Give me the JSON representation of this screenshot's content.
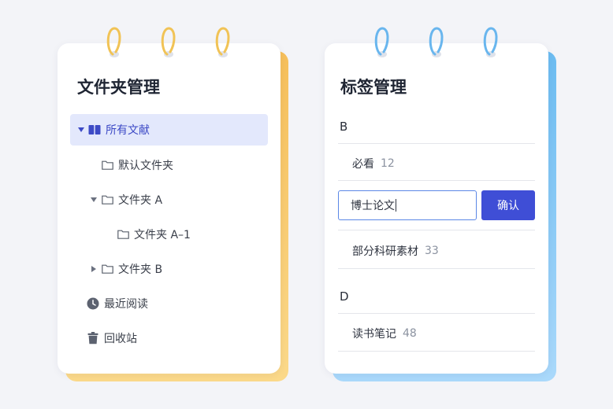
{
  "colors": {
    "left_accent": "#f6bf5b",
    "right_accent": "#6cbcf1",
    "active_bg": "#e3e8fc",
    "active_text": "#3d4ac6",
    "button_bg": "#3f4ed6",
    "input_border": "#5b87e6"
  },
  "folder_panel": {
    "title": "文件夹管理",
    "items": [
      {
        "label": "所有文献",
        "icon": "book-icon",
        "caret": "expanded",
        "active": true
      },
      {
        "label": "默认文件夹",
        "icon": "folder-icon"
      },
      {
        "label": "文件夹 A",
        "icon": "folder-icon",
        "caret": "expanded"
      },
      {
        "label": "文件夹 A–1",
        "icon": "folder-icon"
      },
      {
        "label": "文件夹 B",
        "icon": "folder-icon",
        "caret": "collapsed"
      },
      {
        "label": "最近阅读",
        "icon": "clock-icon"
      },
      {
        "label": "回收站",
        "icon": "trash-icon"
      }
    ]
  },
  "tag_panel": {
    "title": "标签管理",
    "groups": [
      {
        "letter": "B",
        "tags": [
          {
            "name": "必看",
            "count": "12"
          },
          {
            "name": "部分科研素材",
            "count": "33"
          }
        ]
      },
      {
        "letter": "D",
        "tags": [
          {
            "name": "读书笔记",
            "count": "48"
          }
        ]
      }
    ],
    "edit": {
      "value": "博士论文",
      "confirm_label": "确认"
    }
  }
}
